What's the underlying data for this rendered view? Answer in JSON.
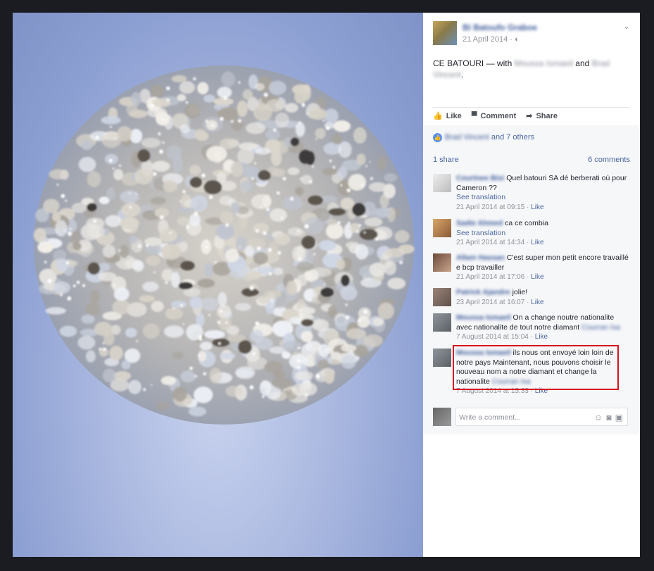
{
  "post": {
    "author_name": "Bi Batoufo Graboe",
    "date": "21 April 2014 · ",
    "privacy_icon": "globe-icon",
    "text_prefix": "CE BATOURI — with ",
    "tagged1": "Moussa Ismaeil",
    "text_and": " and ",
    "tagged2": "Brad Vincent",
    "text_suffix": "."
  },
  "actions": {
    "like": "Like",
    "comment": "Comment",
    "share": "Share"
  },
  "likes": {
    "names": "Brad Vincent",
    "others": " and 7 others"
  },
  "stats": {
    "shares": "1 share",
    "comments": "6 comments"
  },
  "comments": [
    {
      "name": "Courtnee Bisi",
      "text": "Quel batouri SA dé berberati où pour Cameron ??",
      "translation": "See translation",
      "time": "21 April 2014 at 09:15",
      "like": "Like"
    },
    {
      "name": "Sadie Ahmed",
      "text": "ca ce combia",
      "translation": "See translation",
      "time": "21 April 2014 at 14:34",
      "like": "Like"
    },
    {
      "name": "Allam Hassan",
      "text": "C'est super mon petit encore travaillé e bcp travailler",
      "time": "21 April 2014 at 17:06",
      "like": "Like"
    },
    {
      "name": "Patrick Ajandre",
      "text": "jolie!",
      "time": "23 April 2014 at 16:07",
      "like": "Like"
    },
    {
      "name": "Moussa Ismaeil",
      "text": "On a change noutre nationalite avec nationalite de tout notre diamant",
      "mention": "Courran Isa",
      "time": "7 August 2014 at 15:04",
      "like": "Like"
    },
    {
      "name": "Moussa Ismaeil",
      "text": "ils nous ont envoyé loin loin de notre pays Maintenant, nous pouvons choisir le nouveau nom a notre diamant et change la nationalite",
      "mention": "Courran Isa",
      "time": "7 August 2014 at 15:33",
      "like": "Like"
    }
  ],
  "write_comment": {
    "placeholder": "Write a comment..."
  },
  "colors": {
    "link": "#4b67a1",
    "highlight": "#d8131f",
    "background": "#f6f7f9"
  }
}
